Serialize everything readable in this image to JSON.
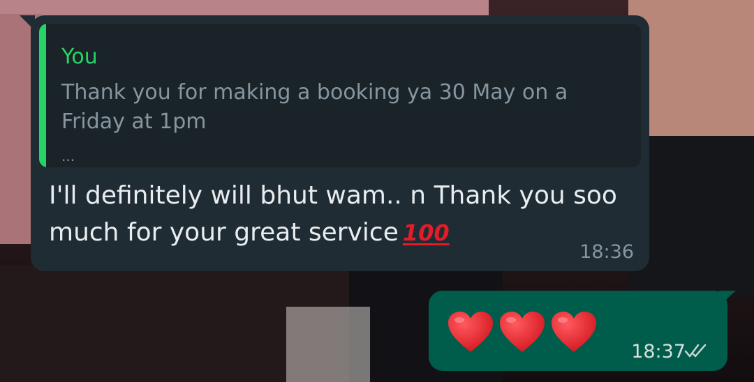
{
  "wallpaper": {
    "description_colors": [
      "#b98489",
      "#24191a",
      "#15161a"
    ]
  },
  "incoming": {
    "quote_author": "You",
    "quote_text": "Thank you for making a booking ya 30 May on a Friday at 1pm",
    "quote_ellipsis": "...",
    "text": "I'll definitely will bhut wam.. n Thank you soo much for your great service",
    "emoji": "100",
    "time": "18:36"
  },
  "outgoing": {
    "hearts": [
      "heart-icon",
      "heart-icon",
      "heart-icon"
    ],
    "time": "18:37",
    "status": "double-tick-icon"
  },
  "colors": {
    "incoming_bubble": "#1f2c33",
    "outgoing_bubble": "#005c4b",
    "quote_accent": "#25d366",
    "heart": "#e3242b"
  }
}
